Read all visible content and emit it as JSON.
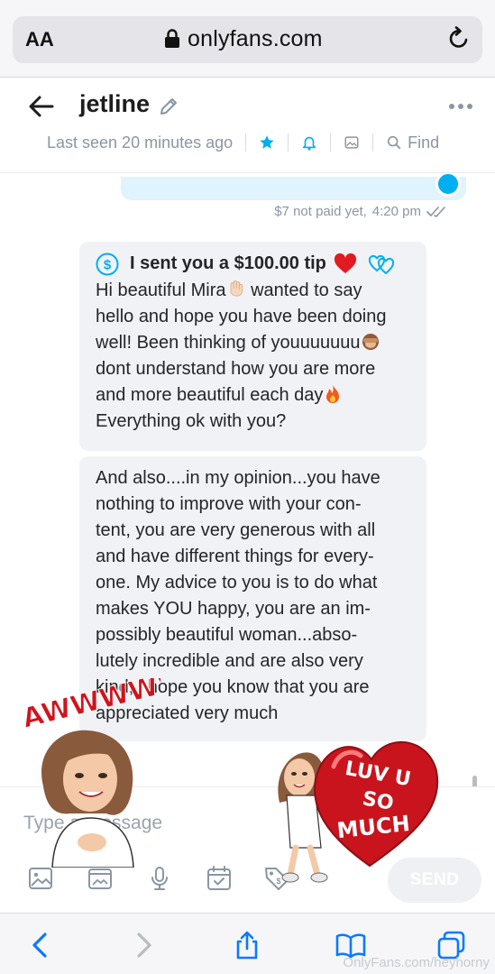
{
  "browser": {
    "aa_label": "AA",
    "url": "onlyfans.com",
    "watermark": "OnlyFans.com/heyhorny"
  },
  "chat": {
    "name": "jetline",
    "last_seen": "Last seen 20 minutes ago",
    "find_label": "Find"
  },
  "messages": [
    {
      "direction": "out",
      "status": "$7 not paid yet,",
      "time": "4:20 pm"
    },
    {
      "direction": "in",
      "tip": "I sent you a $100.00 tip",
      "text_lines": [
        "Hi beautiful Mira",
        " wanted to say",
        "hello and hope you have been doing",
        "well! Been thinking of youuuuuuu",
        "dont understand how you are more",
        "and more beautiful each day",
        "Everything ok with you?"
      ]
    },
    {
      "direction": "in",
      "text": "And also....in my opinion...you have\nnothing to improve with your con-\ntent, you are very generous with all\nand have different things for every-\none. My advice to you is to do what\nmakes YOU happy, you are an im-\npossibly beautiful woman...abso-\nlutely incredible and are also very\nkind, i hope you know that you are\nappreciated very much"
    }
  ],
  "composer": {
    "placeholder": "Type a message",
    "send_label": "SEND"
  },
  "stickers": {
    "left_text": "AWWWWW",
    "right_text": [
      "LUV U",
      "SO",
      "MUCH"
    ]
  },
  "colors": {
    "brand": "#00aff0",
    "bubble_in": "#f1f2f5",
    "bubble_out": "#dff4fc",
    "muted": "#8a96a3"
  }
}
